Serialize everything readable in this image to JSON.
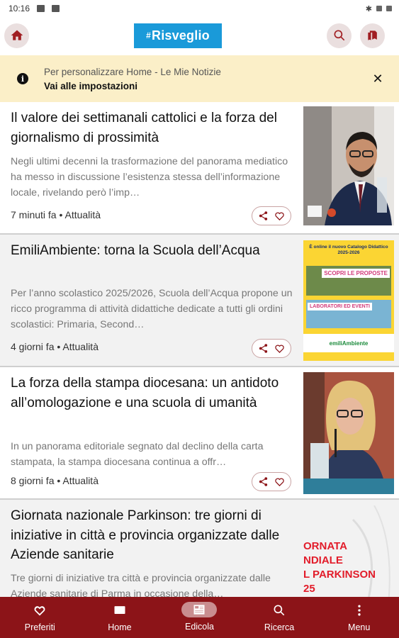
{
  "status_bar": {
    "time": "10:16"
  },
  "app_bar": {
    "logo_hash": "#",
    "logo_text": "Risveglio"
  },
  "notice": {
    "line1": "Per personalizzare Home - Le Mie Notizie",
    "line2": "Vai alle impostazioni"
  },
  "articles": [
    {
      "title": "Il valore dei settimanali cattolici e la forza del giornalismo di prossimità",
      "desc": "Negli ultimi decenni la trasformazione del panorama mediatico ha messo in discussione l’esistenza stessa dell’informazione locale, rivelando però l’imp…",
      "meta": "7 minuti fa • Attualità"
    },
    {
      "title": "EmiliAmbiente: torna la Scuola dell’Acqua",
      "desc": "Per l’anno scolastico 2025/2026, Scuola dell’Acqua propone un ricco programma di attività didattiche dedicate a tutti gli ordini scolastici: Primaria, Second…",
      "meta": "4 giorni fa • Attualità",
      "thumb_text": {
        "top": "È online il nuovo Catalogo Didattico 2025-2026",
        "badge1": "SCOPRI LE PROPOSTE",
        "badge2": "LABORATORI ED EVENTI",
        "brand": "emiliAmbiente"
      }
    },
    {
      "title": "La forza della stampa diocesana: un antidoto all’omologazione e una scuola di umanità",
      "desc": "In un panorama editoriale segnato dal declino della carta stampata, la stampa diocesana continua a offr…",
      "meta": "8 giorni fa • Attualità"
    },
    {
      "title": "Giornata nazionale Parkinson: tre giorni di iniziative in città e provincia organizzate dalle Aziende sanitarie",
      "desc": "Tre giorni di iniziative tra città e provincia organizzate dalle Aziende sanitarie di Parma in occasione della…",
      "meta": "",
      "thumb_text": {
        "l1": "ORNATA",
        "l2": "NDIALE",
        "l3": "L PARKINSON",
        "l4": "25"
      }
    }
  ],
  "bottom_nav": [
    {
      "label": "Preferiti",
      "icon": "heart-icon"
    },
    {
      "label": "Home",
      "icon": "home-icon"
    },
    {
      "label": "Edicola",
      "icon": "newspaper-icon",
      "active": true
    },
    {
      "label": "Ricerca",
      "icon": "search-icon"
    },
    {
      "label": "Menu",
      "icon": "more-vert-icon"
    }
  ],
  "colors": {
    "brand_red": "#8c1418",
    "logo_blue": "#1a9ad9",
    "notice_bg": "#fbefc8"
  }
}
